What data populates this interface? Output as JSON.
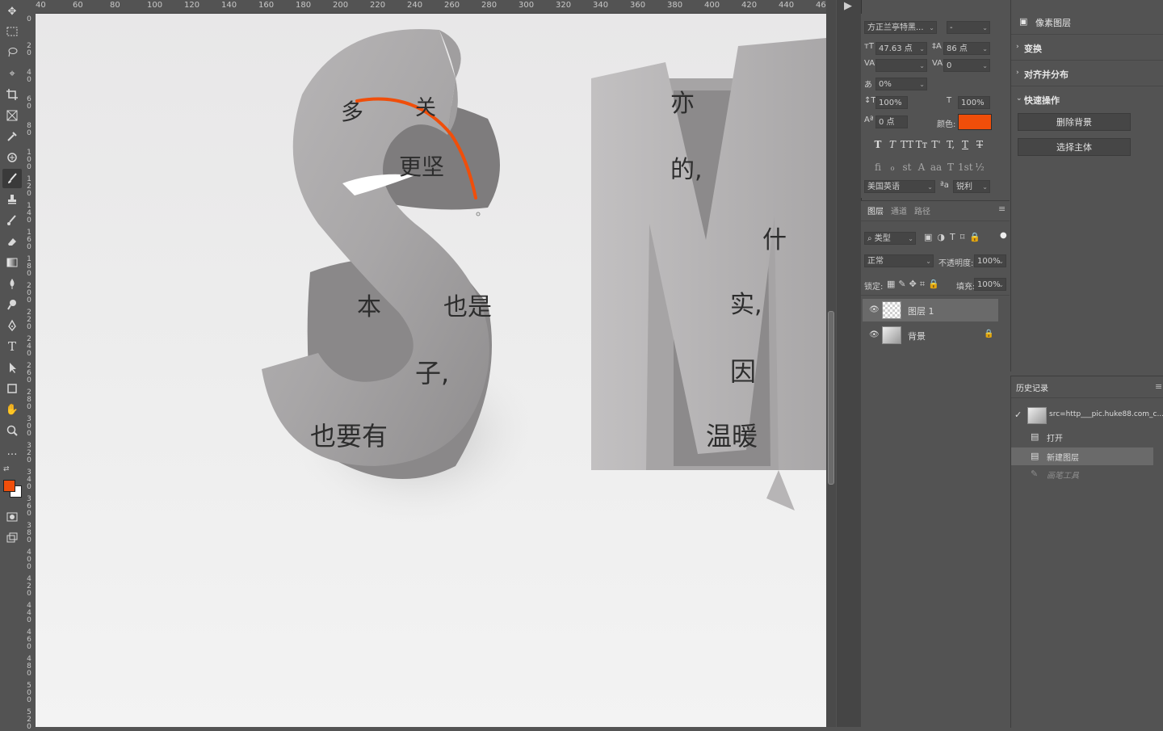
{
  "toolbar": {
    "tools": [
      "move-tool",
      "marquee-tool",
      "lasso-tool",
      "quick-select-tool",
      "crop-tool",
      "frame-tool",
      "eyedropper-tool",
      "healing-tool",
      "brush-tool",
      "stamp-tool",
      "history-brush-tool",
      "eraser-tool",
      "gradient-tool",
      "blur-tool",
      "dodge-tool",
      "pen-tool",
      "type-tool",
      "path-select-tool",
      "rectangle-tool",
      "hand-tool",
      "zoom-tool",
      "more-tools"
    ],
    "foreground_color": "#f04e0a",
    "background_color": "#ffffff"
  },
  "ruler": {
    "top_labels": [
      "40",
      "60",
      "80",
      "100",
      "120",
      "140",
      "160",
      "180",
      "200",
      "220",
      "240",
      "260",
      "280",
      "300",
      "320",
      "340",
      "360",
      "380",
      "400",
      "420",
      "440",
      "460"
    ],
    "left_labels": [
      "0",
      "20",
      "40",
      "60",
      "80",
      "100",
      "120",
      "140",
      "160",
      "180",
      "200",
      "220",
      "240",
      "260",
      "280",
      "300",
      "320",
      "340",
      "360",
      "380",
      "400",
      "420",
      "440",
      "460",
      "480",
      "500",
      "520"
    ]
  },
  "canvas": {
    "letters": [
      "S",
      "M"
    ],
    "text_fragments": [
      "多",
      "关",
      "更坚",
      "本",
      "也是",
      "子,",
      "也要有",
      "亦",
      "的,",
      "什",
      "实,",
      "因",
      "温暖"
    ]
  },
  "character_panel": {
    "font_family": "方正兰亭特黑...",
    "font_style": "-",
    "font_size": "47.63 点",
    "leading": "86 点",
    "kerning": "",
    "tracking": "0",
    "tsume": "0%",
    "vertical_scale": "100%",
    "horizontal_scale": "100%",
    "baseline_shift": "0 点",
    "color_label": "颜色:",
    "color": "#f04e0a",
    "style_glyphs": [
      "T",
      "T",
      "TT",
      "Tт",
      "T'",
      "T,",
      "T",
      "T"
    ],
    "opentype_glyphs": [
      "fi",
      "ℴ",
      "st",
      "A",
      "aa",
      "T",
      "1st",
      "½"
    ],
    "language": "美国英语",
    "aa_icon": "ªa",
    "antialias": "锐利"
  },
  "layers_panel": {
    "tabs": [
      "图层",
      "通道",
      "路径"
    ],
    "filter_kind": "类型",
    "blend_mode": "正常",
    "opacity_label": "不透明度:",
    "opacity": "100%",
    "lock_label": "锁定:",
    "fill_label": "填充:",
    "fill": "100%",
    "layers": [
      {
        "name": "图层 1",
        "selected": true
      },
      {
        "name": "背景",
        "selected": false,
        "locked": true
      }
    ]
  },
  "properties_panel": {
    "title": "像素图层",
    "sections": [
      "变换",
      "对齐并分布",
      "快速操作"
    ],
    "buttons": [
      "删除背景",
      "选择主体"
    ]
  },
  "history_panel": {
    "title": "历史记录",
    "snapshot": "src=http___pic.huke88.com_c...",
    "items": [
      {
        "label": "打开",
        "selected": false,
        "dim": false
      },
      {
        "label": "新建图层",
        "selected": true,
        "dim": false
      },
      {
        "label": "画笔工具",
        "selected": false,
        "dim": true
      }
    ]
  }
}
